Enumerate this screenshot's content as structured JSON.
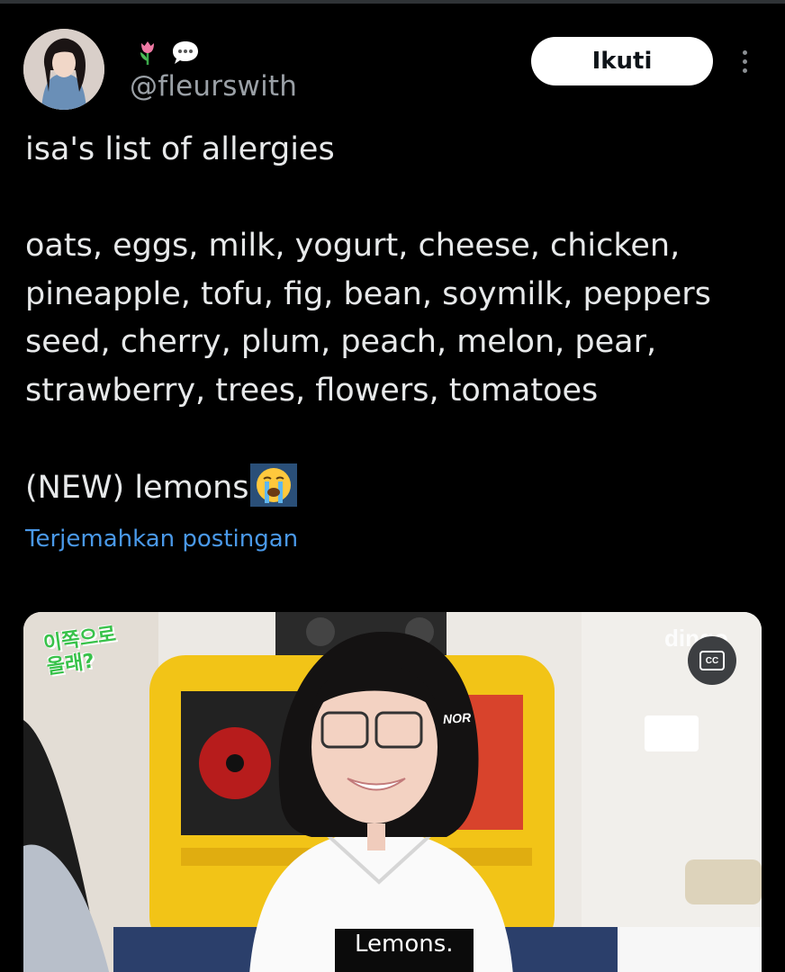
{
  "tweet": {
    "handle": "@fleurswith",
    "badges": [
      "tulip-emoji",
      "speech-bubble-emoji"
    ],
    "follow_label": "Ikuti",
    "text_title": "isa's list of allergies",
    "text_list": "oats, eggs, milk, yogurt, cheese, chicken,\npineapple, tofu, fig, bean, soymilk, peppers\nseed, cherry, plum, peach, melon, pear,\nstrawberry, trees, flowers, tomatoes",
    "text_new": "(NEW) lemons",
    "new_emoji": "loudly-crying-face",
    "translate_label": "Terjemahkan postingan"
  },
  "media": {
    "type": "video",
    "show_logo": "이쪽으로\n올래?",
    "watermark": "dingo",
    "shelf_label": "NOR",
    "cc_label": "CC",
    "subtitle": "Lemons."
  },
  "colors": {
    "background": "#000000",
    "text": "#e7e9ea",
    "muted": "#9aa0a6",
    "link": "#4a99e9",
    "button_bg": "#ffffff"
  }
}
